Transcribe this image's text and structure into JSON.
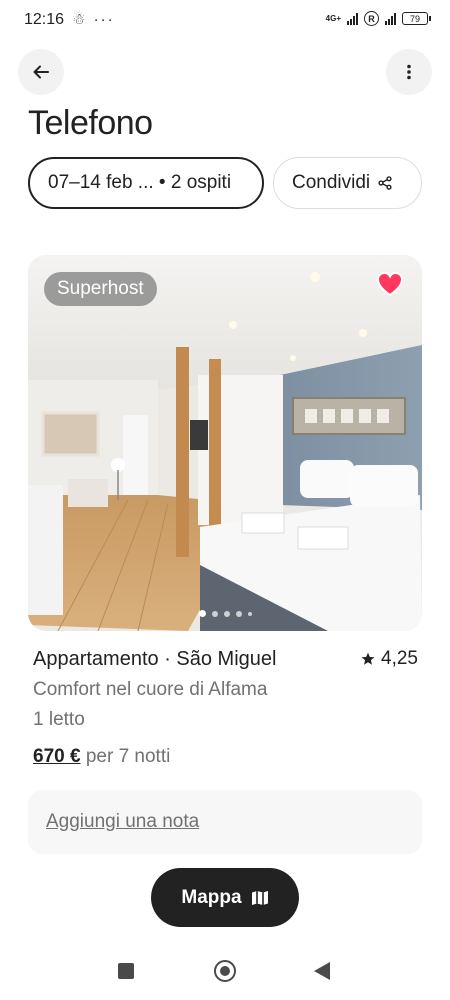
{
  "status_bar": {
    "time": "12:16",
    "left_icons": "☃ ···",
    "network": "4G+",
    "r_badge": "R",
    "battery": "79"
  },
  "header": {
    "back_icon": "arrow-left-icon",
    "more_icon": "more-vertical-icon"
  },
  "page_title": "Telefono",
  "trip": {
    "dates_guests": "07–14 feb ... • 2 ospiti",
    "share_label": "Condividi",
    "share_icon": "share-icon"
  },
  "listing": {
    "badge": "Superhost",
    "favorite_icon": "heart-icon",
    "favorite_color": "#ff385c",
    "photo_index": 1,
    "photo_count": 5,
    "title": "Appartamento · São Miguel",
    "rating": "4,25",
    "description": "Comfort nel cuore di Alfama",
    "beds": "1 letto",
    "price": "670 €",
    "price_period": "per 7 notti"
  },
  "note": {
    "label": "Aggiungi una nota"
  },
  "map_button": {
    "label": "Mappa",
    "icon": "map-icon"
  },
  "nav_bar": {
    "recents_icon": "square-icon",
    "home_icon": "circle-icon",
    "back_icon": "triangle-back-icon"
  },
  "colors": {
    "text": "#222222",
    "secondary_text": "#717171",
    "accent": "#ff385c",
    "map_button": "#222222"
  }
}
